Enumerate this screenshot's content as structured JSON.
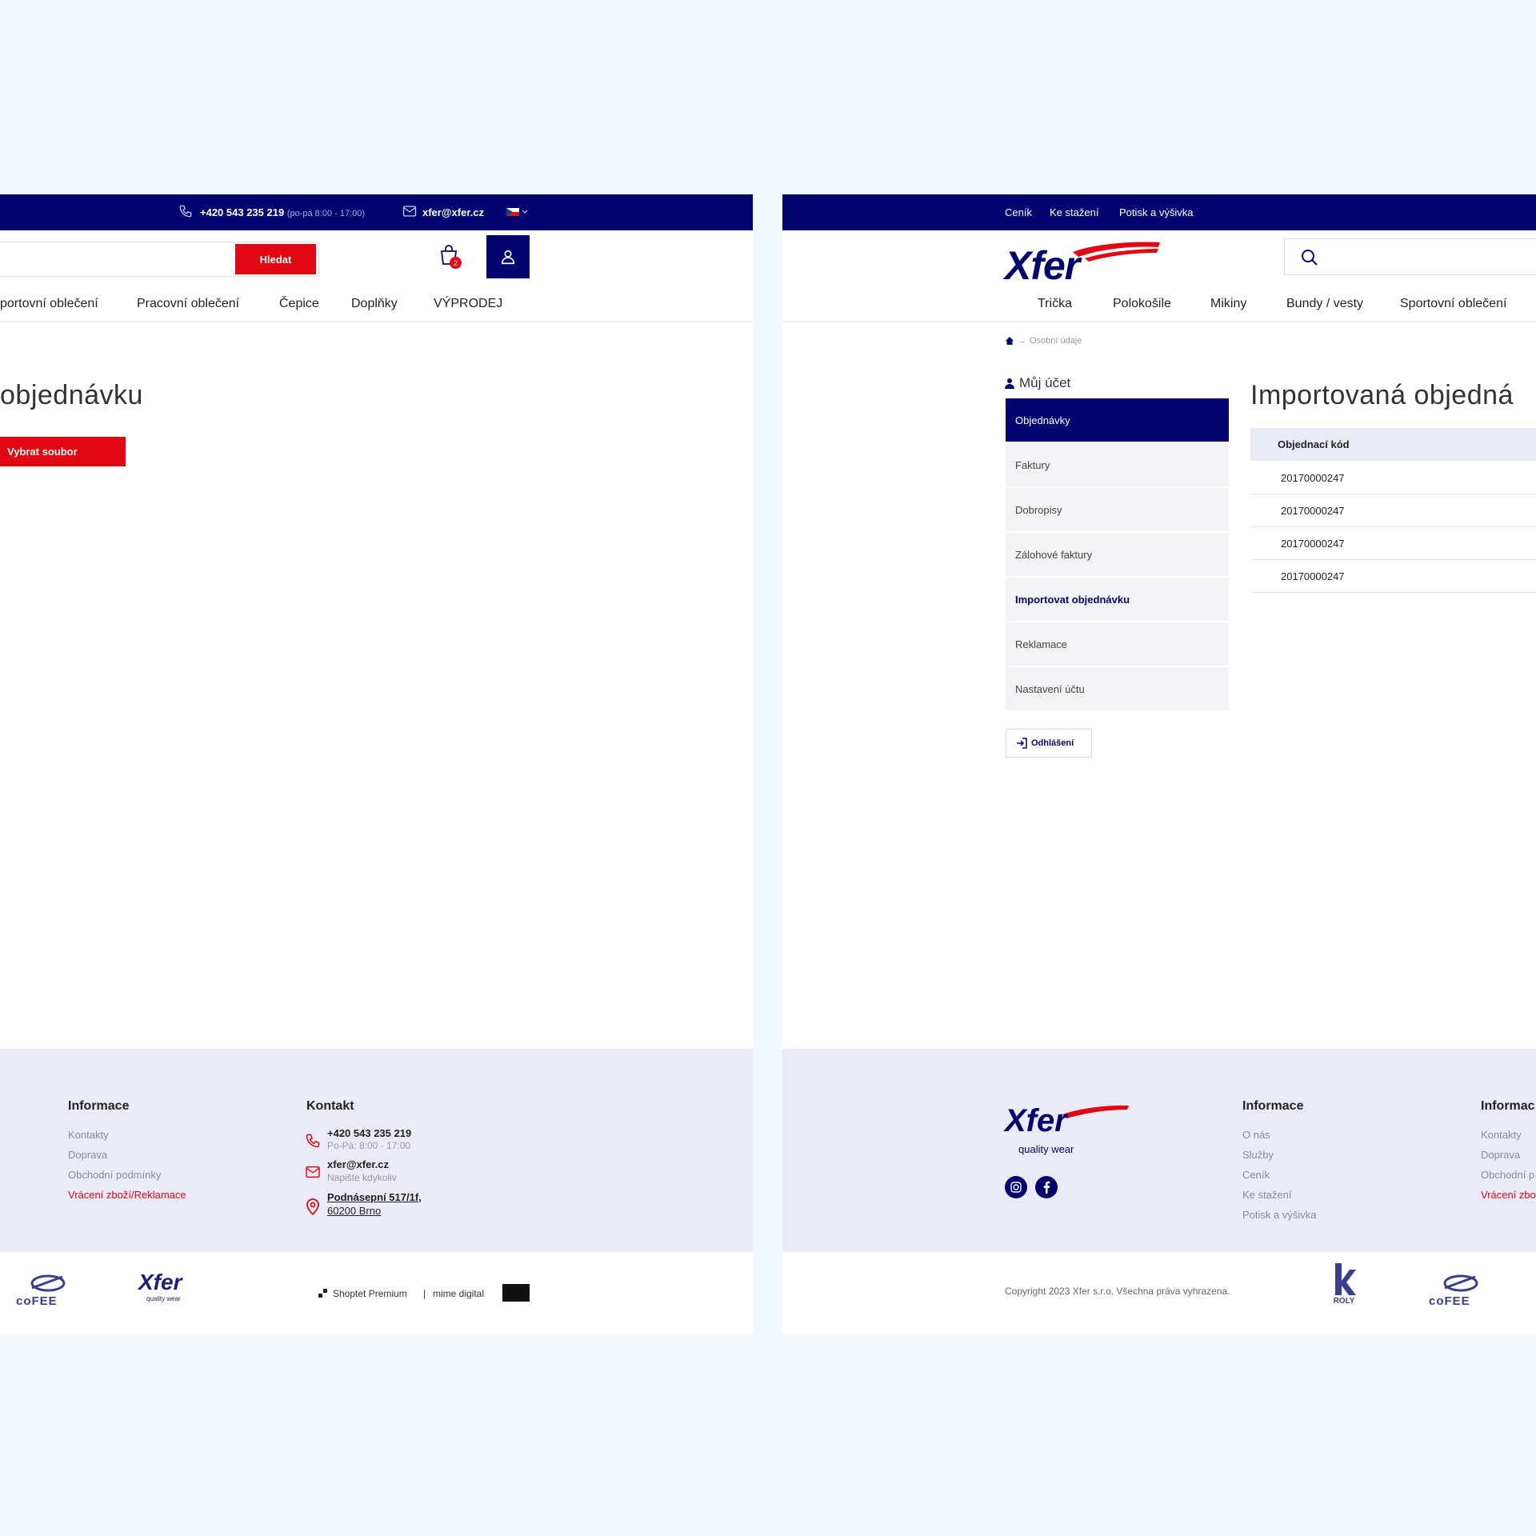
{
  "left": {
    "topbar": {
      "phone": "+420 543 235 219",
      "phone_hours": "(po-pá 8:00 - 17:00)",
      "email": "xfer@xfer.cz"
    },
    "search_button": "Hledat",
    "cart_count": "2",
    "nav": [
      "portovní oblečení",
      "Pracovní oblečení",
      "Čepice",
      "Doplňky",
      "VÝPRODEJ"
    ],
    "page_title": "objednávku",
    "file_button": "Vybrat soubor",
    "footer": {
      "informace_heading": "Informace",
      "informace_links": [
        "Kontakty",
        "Doprava",
        "Obchodní podmínky",
        "Vrácení zboží/Reklamace"
      ],
      "kontakt_heading": "Kontakt",
      "phone": "+420 543 235 219",
      "phone_hours": "Po-Pá: 8:00 - 17:00",
      "email": "xfer@xfer.cz",
      "email_sub": "Napište kdykoliv",
      "address_line1": "Podnásepní 517/1f,",
      "address_line2": "60200 Brno"
    },
    "footer_bottom": {
      "cofee_logo": "coFEE",
      "xfer_logo": "Xfer",
      "xfer_tagline": "quality wear",
      "shoptet": "Shoptet Premium",
      "separator": "|",
      "mime": "mime digital"
    }
  },
  "right": {
    "topbar_links": [
      "Ceník",
      "Ke stažení",
      "Potisk a výšivka"
    ],
    "logo": "Xfer",
    "nav": [
      "Trička",
      "Polokošile",
      "Mikiny",
      "Bundy / vesty",
      "Sportovní oblečení"
    ],
    "breadcrumb": "Osobní údaje",
    "breadcrumb_separator": "→",
    "account_heading": "Můj účet",
    "sidebar": [
      "Objednávky",
      "Faktury",
      "Dobropisy",
      "Zálohové faktury",
      "Importovat objednávku",
      "Reklamace",
      "Nastavení účtu"
    ],
    "logout": "Odhlášení",
    "page_title": "Importovaná objedná",
    "table_header": "Objednací kód",
    "table_rows": [
      "20170000247",
      "20170000247",
      "20170000247",
      "20170000247"
    ],
    "footer": {
      "logo": "Xfer",
      "tagline": "quality wear",
      "informace1_heading": "Informace",
      "informace1_links": [
        "O nás",
        "Služby",
        "Ceník",
        "Ke stažení",
        "Potisk a výšivka"
      ],
      "informace2_heading": "Informac",
      "informace2_links": [
        "Kontakty",
        "Doprava",
        "Obchodní p",
        "Vrácení zbo"
      ]
    },
    "footer_bottom": {
      "copyright": "Copyright 2023 Xfer s.r.o. Všechna práva vyhrazena.",
      "roly": "ROLY",
      "cofee": "coFEE"
    }
  },
  "colors": {
    "brand_navy": "#020570",
    "brand_red": "#e30613",
    "page_bg": "#f3f8fc",
    "footer_bg": "#ebebf7"
  },
  "icons": [
    "phone-icon",
    "mail-icon",
    "flag-cz-icon",
    "cart-icon",
    "user-icon",
    "home-icon",
    "user-small-icon",
    "logout-icon",
    "search-icon",
    "location-icon",
    "instagram-icon",
    "facebook-icon"
  ]
}
